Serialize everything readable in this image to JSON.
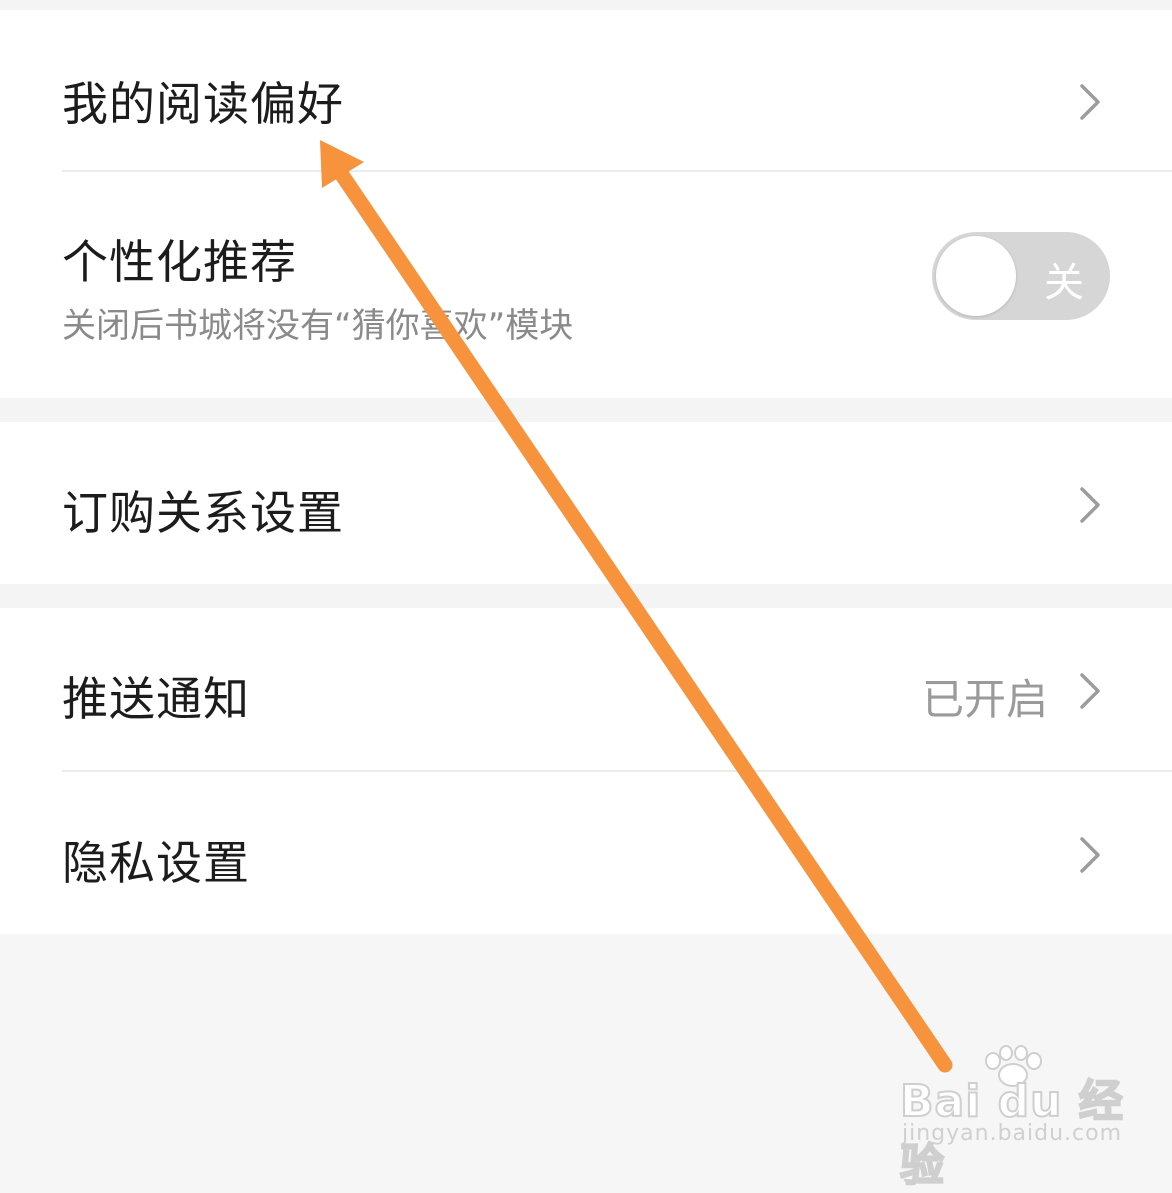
{
  "settings": {
    "reading_pref": {
      "label": "我的阅读偏好"
    },
    "personalized": {
      "label": "个性化推荐",
      "description": "关闭后书城将没有“猜你喜欢”模块",
      "toggle_label": "关",
      "enabled": false
    },
    "subscription": {
      "label": "订购关系设置"
    },
    "push": {
      "label": "推送通知",
      "status": "已开启"
    },
    "privacy": {
      "label": "隐私设置"
    }
  },
  "icons": {
    "row_chevron": "chevron-right-icon",
    "watermark_logo": "paw-icon"
  },
  "annotation": {
    "arrow_color": "#f7923d"
  },
  "watermark": {
    "brand": "Bai du 经验",
    "url": "jingyan.baidu.com"
  }
}
